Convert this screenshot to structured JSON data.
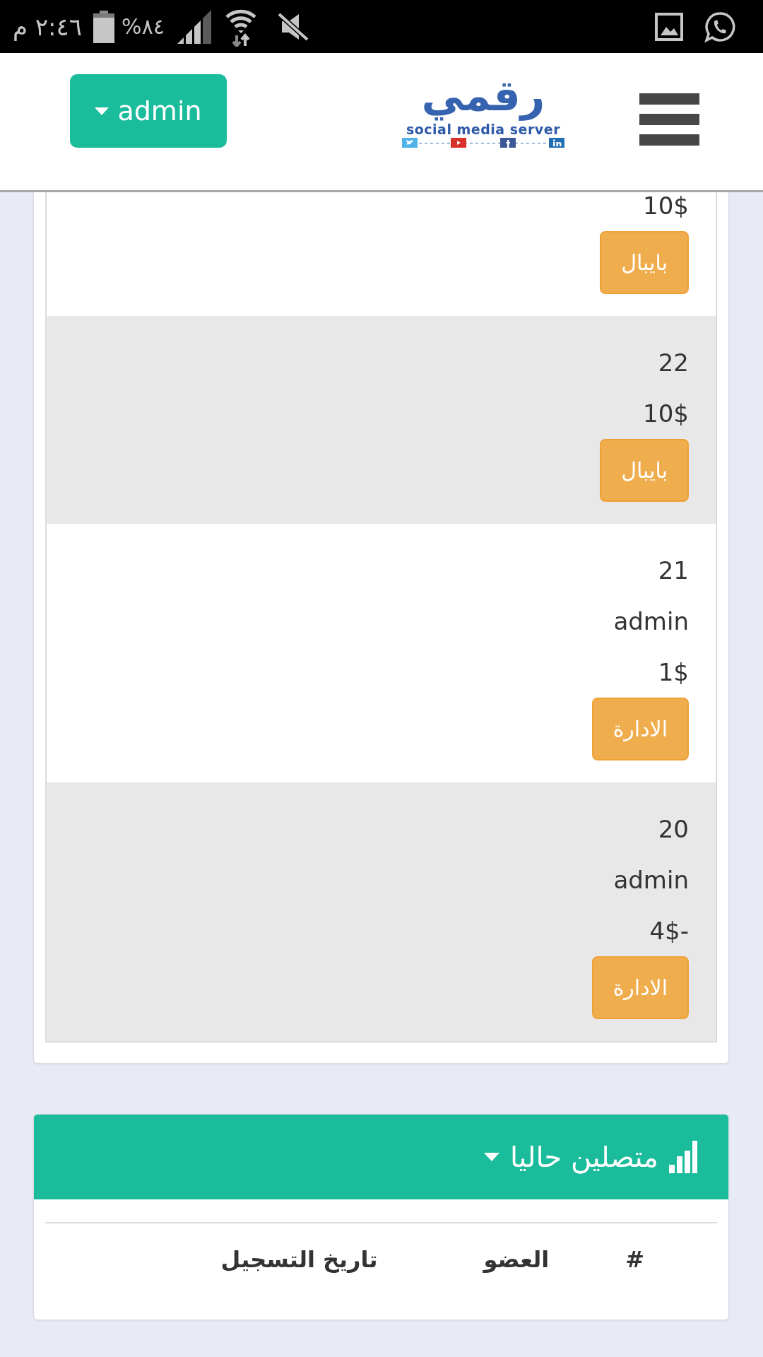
{
  "status_bar": {
    "time": "٢:٤٦ م",
    "battery": "%٨٤"
  },
  "header": {
    "user_menu": "admin",
    "logo": {
      "word": "رقمي",
      "tagline": "social media server"
    }
  },
  "transactions": {
    "rows": [
      {
        "values": [
          "10$"
        ],
        "button": "بايبال"
      },
      {
        "values": [
          "22",
          "10$"
        ],
        "button": "بايبال"
      },
      {
        "values": [
          "21",
          "admin",
          "1$"
        ],
        "button": "الادارة"
      },
      {
        "values": [
          "20",
          "admin",
          "4$-"
        ],
        "button": "الادارة"
      }
    ]
  },
  "online_now": {
    "title": "متصلين حاليا",
    "columns": [
      "#",
      "العضو",
      "تاريخ التسجيل"
    ]
  }
}
